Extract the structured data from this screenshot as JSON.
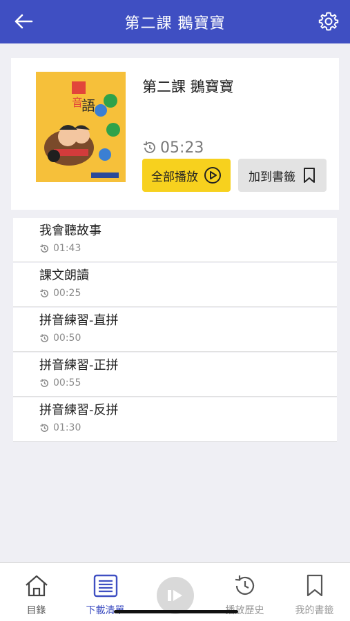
{
  "header": {
    "title": "第二課 鵝寶寶",
    "back_icon": "arrow-left-icon",
    "settings_icon": "gear-icon",
    "color": "#3f4fc2"
  },
  "lesson": {
    "title": "第二課 鵝寶寶",
    "duration": "05:23",
    "play_all_label": "全部播放",
    "bookmark_label": "加到書籤",
    "play_button_color": "#f7d11e"
  },
  "tracks": [
    {
      "name": "我會聽故事",
      "duration": "01:43"
    },
    {
      "name": "課文朗讀",
      "duration": "00:25"
    },
    {
      "name": "拼音練習-直拼",
      "duration": "00:50"
    },
    {
      "name": "拼音練習-正拼",
      "duration": "00:55"
    },
    {
      "name": "拼音練習-反拼",
      "duration": "01:30"
    }
  ],
  "tabbar": {
    "tabs": [
      {
        "label": "目錄",
        "icon": "home-icon"
      },
      {
        "label": "下載清單",
        "icon": "list-icon"
      },
      {
        "label": "",
        "icon": "play-pause-icon"
      },
      {
        "label": "播放歷史",
        "icon": "history-icon"
      },
      {
        "label": "我的書籤",
        "icon": "bookmark-icon"
      }
    ],
    "active_color": "#3f4fc2"
  }
}
